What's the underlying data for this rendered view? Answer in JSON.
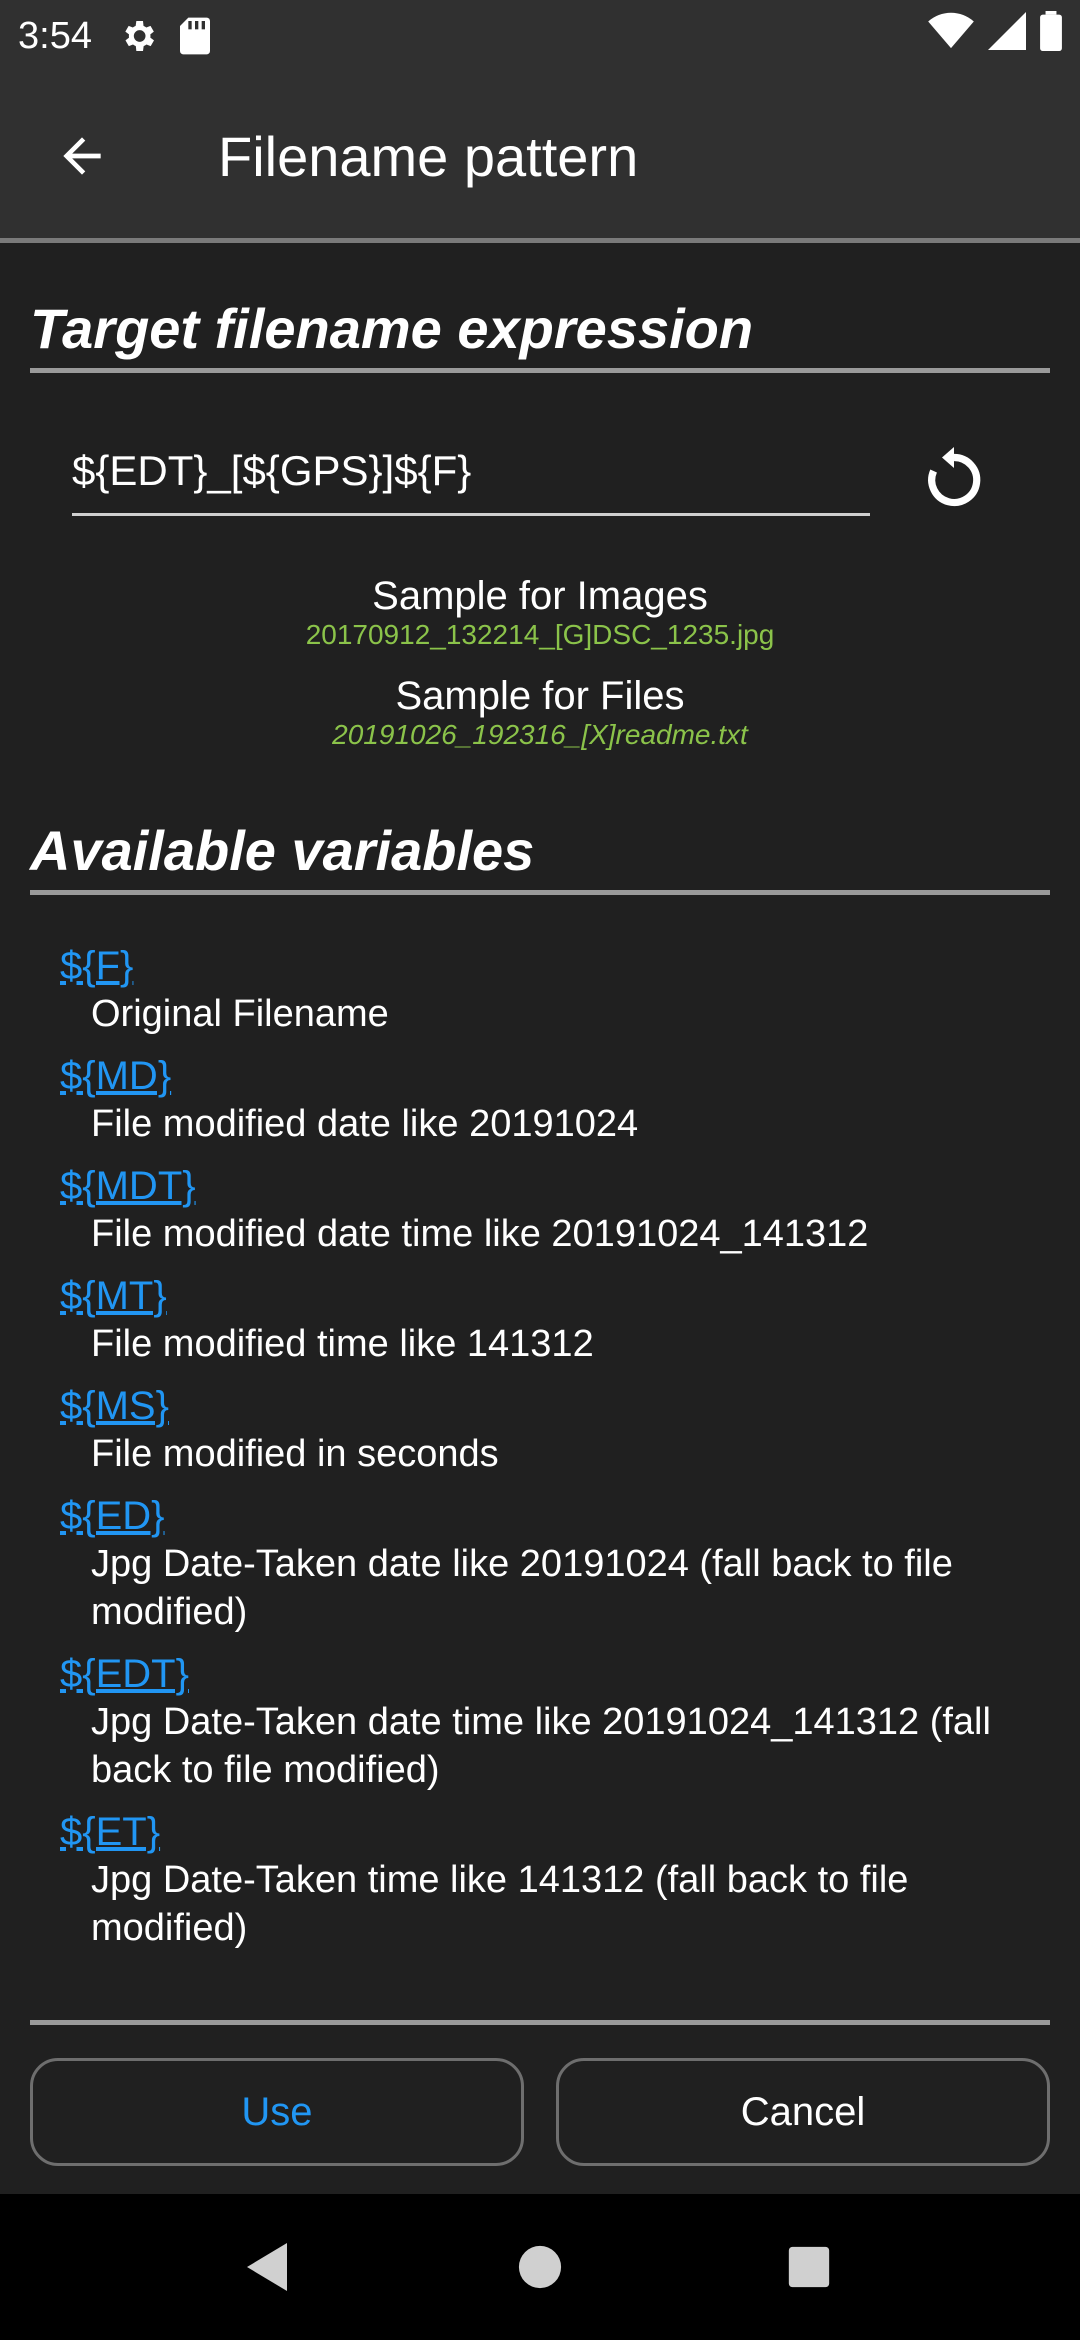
{
  "status_bar": {
    "time": "3:54",
    "icons_left": [
      "gear-icon",
      "sd-card-icon"
    ],
    "icons_right": [
      "wifi-icon",
      "cell-signal-icon",
      "battery-icon"
    ]
  },
  "app_bar": {
    "title": "Filename pattern",
    "back_icon": "arrow-left-icon"
  },
  "target_section": {
    "title": "Target filename expression",
    "expression_value": "${EDT}_[${GPS}]${F}",
    "reset_icon": "refresh-icon",
    "sample_images_label": "Sample for Images",
    "sample_images_value": "20170912_132214_[G]DSC_1235.jpg",
    "sample_files_label": "Sample for Files",
    "sample_files_value": "20191026_192316_[X]readme.txt"
  },
  "variables_section": {
    "title": "Available variables",
    "items": [
      {
        "name": "${F}",
        "desc": "Original Filename"
      },
      {
        "name": "${MD}",
        "desc": "File modified date like 20191024"
      },
      {
        "name": "${MDT}",
        "desc": "File modified date time like 20191024_141312"
      },
      {
        "name": "${MT}",
        "desc": "File modified time like 141312"
      },
      {
        "name": "${MS}",
        "desc": "File modified in seconds"
      },
      {
        "name": "${ED}",
        "desc": "Jpg Date-Taken date like 20191024 (fall back to file modified)"
      },
      {
        "name": "${EDT}",
        "desc": "Jpg Date-Taken date time like 20191024_141312 (fall back to file modified)"
      },
      {
        "name": "${ET}",
        "desc": "Jpg Date-Taken time like 141312 (fall back to file modified)"
      }
    ]
  },
  "buttons": {
    "use_label": "Use",
    "cancel_label": "Cancel"
  },
  "colors": {
    "background": "#202020",
    "app_bar": "#303030",
    "accent_link": "#2196f3",
    "sample_green": "#8bc34a"
  },
  "nav_bar": {
    "icons": [
      "back-triangle-icon",
      "home-circle-icon",
      "recents-square-icon"
    ]
  }
}
